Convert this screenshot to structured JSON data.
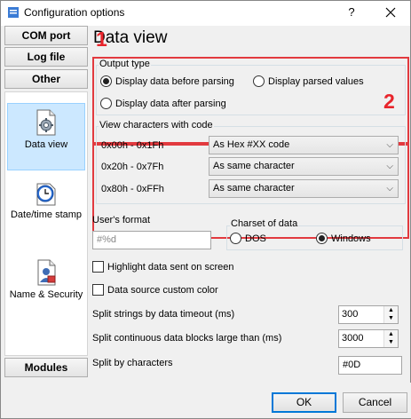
{
  "window": {
    "title": "Configuration options",
    "help_label": "?",
    "close_label": "✕"
  },
  "sidebar": {
    "top_buttons": [
      "COM port",
      "Log file",
      "Other"
    ],
    "items": [
      {
        "label": "Data view",
        "icon": "gear-document-icon",
        "selected": true
      },
      {
        "label": "Date/time stamp",
        "icon": "clock-icon",
        "selected": false
      },
      {
        "label": "Name & Security",
        "icon": "security-document-icon",
        "selected": false
      }
    ],
    "bottom_button": "Modules"
  },
  "page": {
    "title": "Data view",
    "markers": [
      "1",
      "2"
    ],
    "output_type": {
      "label": "Output type",
      "options": [
        {
          "label": "Display data before parsing",
          "checked": true
        },
        {
          "label": "Display parsed values",
          "checked": false
        },
        {
          "label": "Display data after parsing",
          "checked": false
        }
      ]
    },
    "view_chars": {
      "label": "View characters with code",
      "rows": [
        {
          "range": "0x00h - 0x1Fh",
          "value": "As Hex #XX code"
        },
        {
          "range": "0x20h - 0x7Fh",
          "value": "As same character"
        },
        {
          "range": "0x80h - 0xFFh",
          "value": "As same character"
        }
      ]
    },
    "users_format": {
      "label": "User's format",
      "placeholder": "#%d"
    },
    "charset": {
      "label": "Charset of data",
      "options": [
        {
          "label": "DOS",
          "checked": false
        },
        {
          "label": "Windows",
          "checked": true
        }
      ]
    },
    "highlight_label": "Highlight data sent on screen",
    "custom_color_label": "Data source custom color",
    "split_timeout": {
      "label": "Split strings by data timeout (ms)",
      "value": "300"
    },
    "split_blocks": {
      "label": "Split continuous data blocks large than (ms)",
      "value": "3000"
    },
    "split_chars": {
      "label": "Split by characters",
      "value": "#0D"
    }
  },
  "footer": {
    "ok_label": "OK",
    "cancel_label": "Cancel"
  },
  "colors": {
    "highlight_red": "#e23a3f",
    "selection_blue": "#cce8ff",
    "default_button_border": "#0078d7"
  }
}
